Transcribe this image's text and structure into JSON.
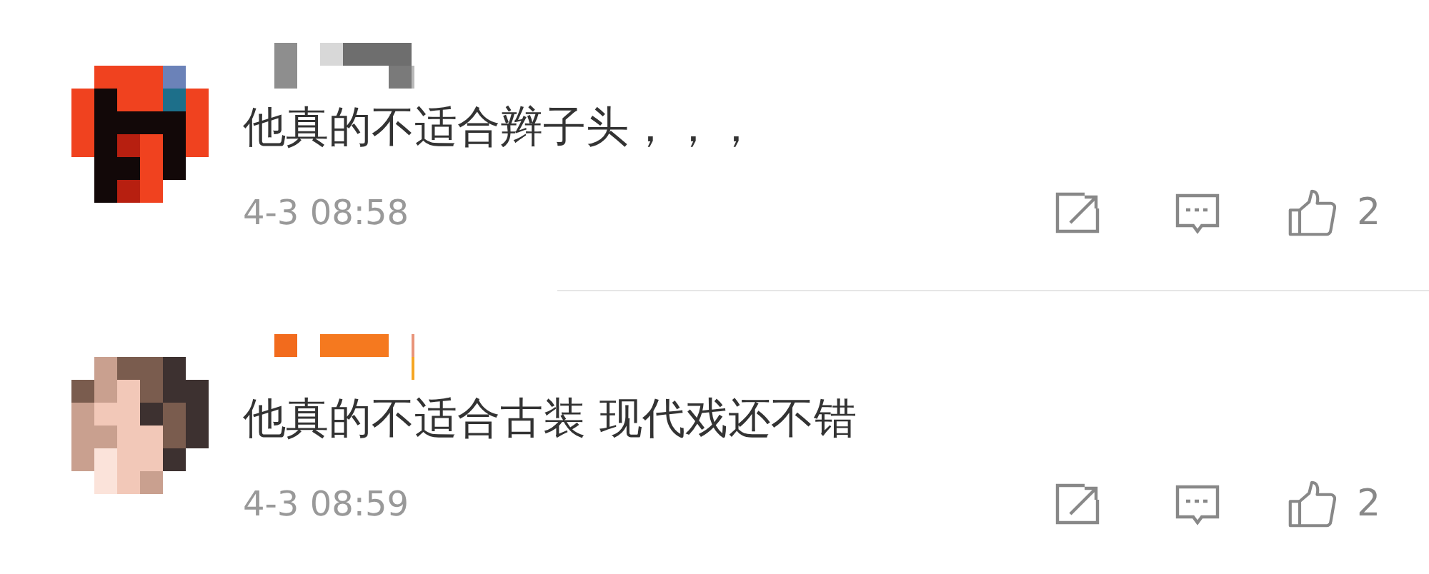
{
  "comments": [
    {
      "text": "他真的不适合辫子头，，，",
      "time": "4-3 08:58",
      "likes": "2"
    },
    {
      "text": "他真的不适合古装 现代戏还不错",
      "time": "4-3 08:59",
      "likes": "2"
    }
  ]
}
